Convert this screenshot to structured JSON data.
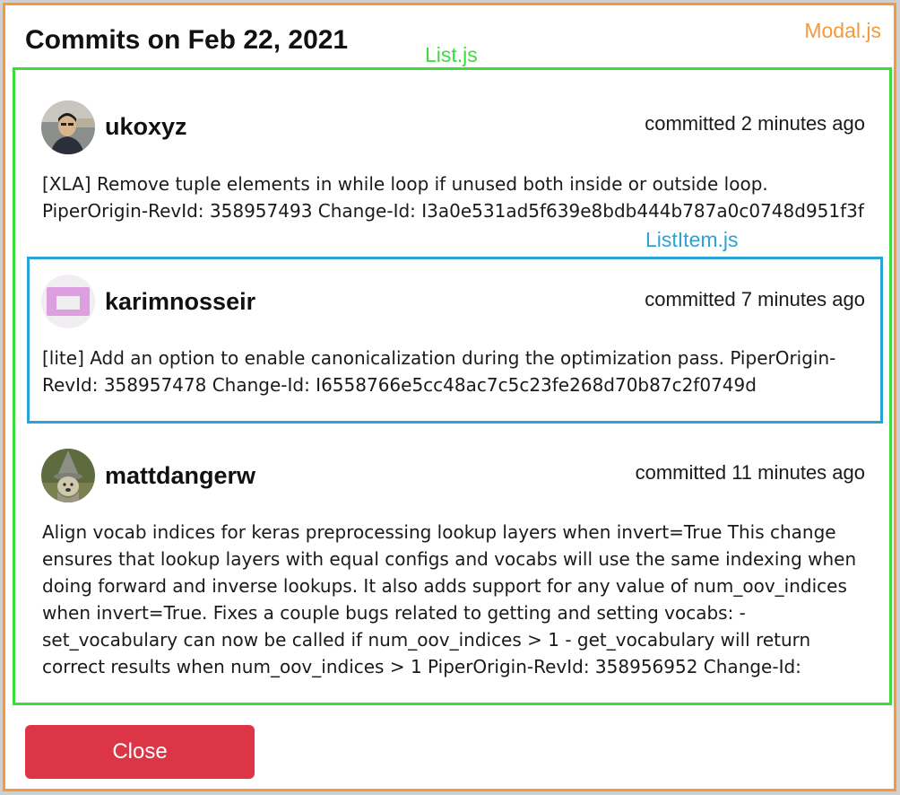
{
  "modal": {
    "title": "Commits on Feb 22, 2021",
    "close_label": "Close"
  },
  "annotations": {
    "modal_js": "Modal.js",
    "list_js": "List.js",
    "list_item_js": "ListItem.js"
  },
  "colors": {
    "modal_outline": "#f39a3d",
    "list_outline": "#3ddc3d",
    "list_item_outline": "#2aa3d6",
    "close_button": "#dc3545"
  },
  "commits": [
    {
      "username": "ukoxyz",
      "time": "committed 2 minutes ago",
      "message": "[XLA] Remove tuple elements in while loop if unused both inside or outside loop. PiperOrigin-RevId: 358957493 Change-Id: I3a0e531ad5f639e8bdb444b787a0c0748d951f3f",
      "avatar_icon": "user-photo-avatar"
    },
    {
      "username": "karimnosseir",
      "time": "committed 7 minutes ago",
      "message": "[lite] Add an option to enable canonicalization during the optimization pass. PiperOrigin-RevId: 358957478 Change-Id: I6558766e5cc48ac7c5c23fe268d70b87c2f0749d",
      "avatar_icon": "identicon-avatar"
    },
    {
      "username": "mattdangerw",
      "time": "committed 11 minutes ago",
      "message": "Align vocab indices for keras preprocessing lookup layers when invert=True This change ensures that lookup layers with equal configs and vocabs will use the same indexing when doing forward and inverse lookups. It also adds support for any value of num_oov_indices when invert=True. Fixes a couple bugs related to getting and setting vocabs: - set_vocabulary can now be called if num_oov_indices > 1 - get_vocabulary will return correct results when num_oov_indices > 1 PiperOrigin-RevId: 358956952 Change-Id:",
      "avatar_icon": "wizard-dog-avatar"
    }
  ]
}
